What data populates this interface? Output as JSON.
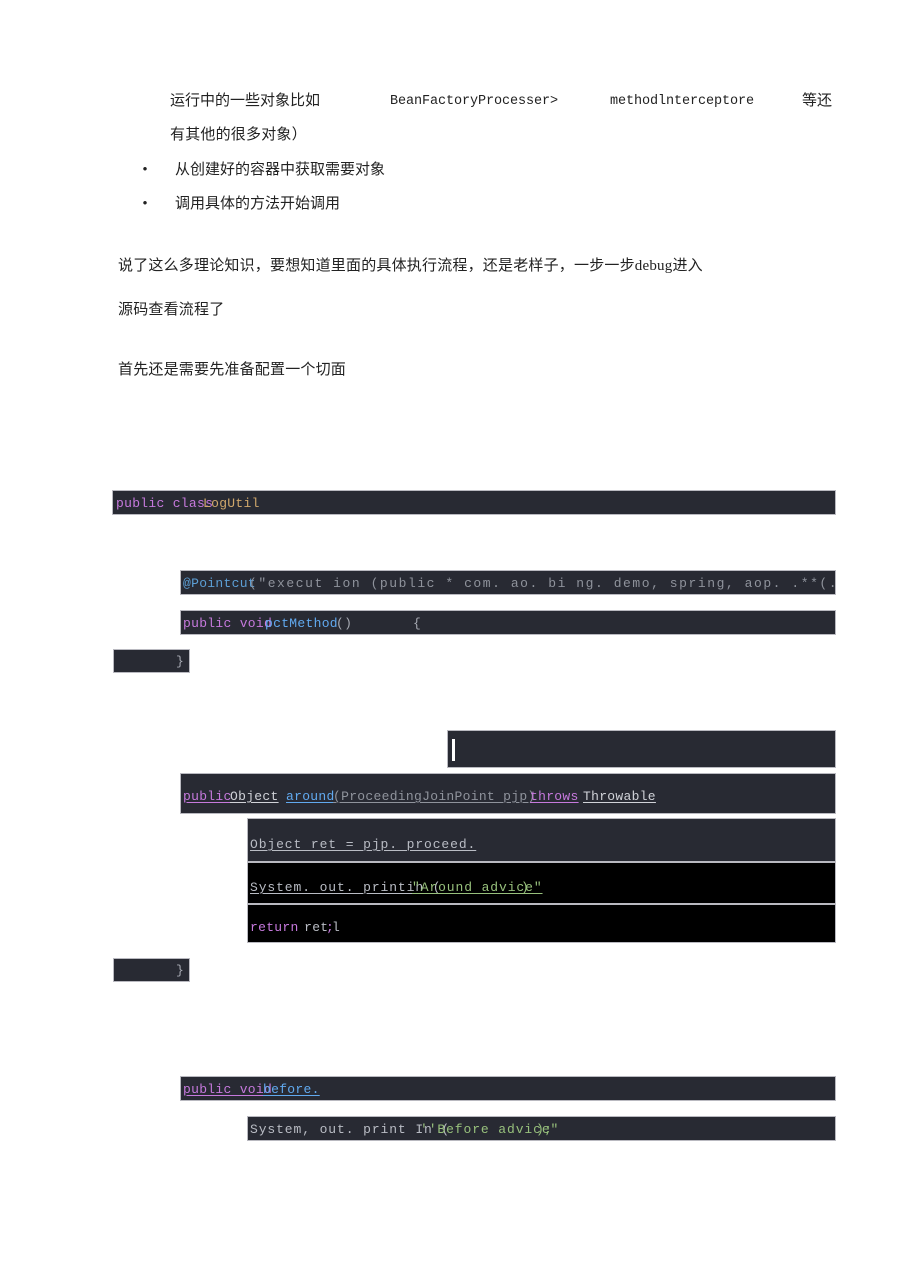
{
  "document": {
    "intro_line": {
      "part1": "运行中的一些对象比如",
      "part2": "BeanFactoryProcesser>",
      "part3": "methodlnterceptore",
      "part4": "等还"
    },
    "intro_line2": "有其他的很多对象）",
    "bullets": [
      {
        "marker": "•",
        "text": "从创建好的容器中获取需要对象"
      },
      {
        "marker": "•",
        "text": "调用具体的方法开始调用"
      }
    ],
    "paragraphs": [
      "说了这么多理论知识，要想知道里面的具体执行流程，还是老样子，一步一步debug进入",
      "源码查看流程了",
      "首先还是需要先准备配置一个切面"
    ]
  },
  "code": {
    "block_class": {
      "kw": "public class",
      "name": "LogUtil"
    },
    "block_pointcut": {
      "annotation": "@Pointcut",
      "args": "(\"execut ion (public * com. ao. bi ng. demo, spring, aop. .**(.. ))\")"
    },
    "block_pctmethod": {
      "kw": "public void",
      "name": "pctMethod",
      "parens": "()",
      "brace": "{"
    },
    "brace_close_1": "}",
    "block_around_sig": {
      "kw1": "public",
      "type1": "Object",
      "name": "around",
      "params": "(ProceedingJoinPoint pjp)",
      "kw2": "throws",
      "type2": "Throwable"
    },
    "block_proceed": "Object ret = pjp. proceed.",
    "block_around_print": {
      "call": "System. out. printin (",
      "str": "\"Around advice\"",
      "tail": ")"
    },
    "block_return": {
      "kw": "return",
      "value": " ret",
      "semi": ";",
      "extra": "l"
    },
    "brace_close_2": "}",
    "block_before_sig": {
      "kw": "public void",
      "name": "before."
    },
    "block_before_print": {
      "call": "System, out. print In (",
      "str": "''Before advice\"",
      "tail": ");"
    }
  }
}
